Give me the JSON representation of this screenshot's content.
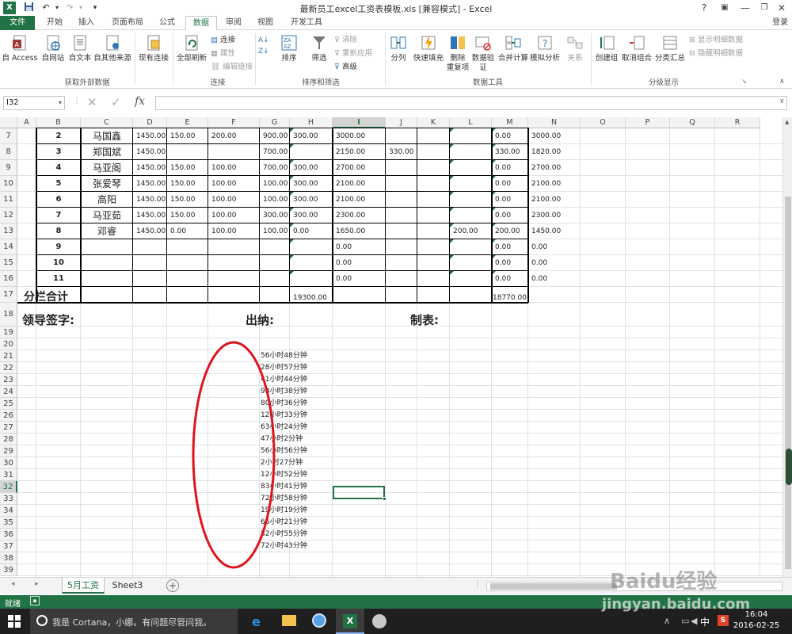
{
  "window": {
    "title": "最新员工excel工资表模板.xls  [兼容模式] - Excel",
    "login": "登录"
  },
  "menu_tabs": [
    "文件",
    "开始",
    "插入",
    "页面布局",
    "公式",
    "数据",
    "审阅",
    "视图",
    "开发工具"
  ],
  "active_tab": "数据",
  "ribbon": {
    "groups": {
      "external": "获取外部数据",
      "connections": "连接",
      "sort_filter": "排序和筛选",
      "data_tools": "数据工具",
      "outline": "分级显示"
    },
    "buttons": {
      "from_access": "自 Access",
      "from_web": "自网站",
      "from_text": "自文本",
      "from_other": "自其他来源",
      "existing": "现有连接",
      "refresh_all": "全部刷新",
      "connections": "连接",
      "properties": "属性",
      "edit_links": "编辑链接",
      "sort": "排序",
      "filter": "筛选",
      "clear": "清除",
      "reapply": "重新应用",
      "advanced": "高级",
      "text_to_cols": "分列",
      "flash_fill": "快速填充",
      "remove_dup_1": "删除",
      "remove_dup_2": "重复项",
      "validation_1": "数据验",
      "validation_2": "证",
      "consolidate": "合并计算",
      "what_if": "模拟分析",
      "relationships": "关系",
      "group": "创建组",
      "ungroup": "取消组合",
      "subtotal": "分类汇总",
      "show_detail": "显示明细数据",
      "hide_detail": "隐藏明细数据"
    }
  },
  "formula_bar": {
    "name_box": "I32",
    "formula": ""
  },
  "columns": [
    "A",
    "B",
    "C",
    "D",
    "E",
    "F",
    "G",
    "H",
    "I",
    "J",
    "K",
    "L",
    "M",
    "N",
    "O",
    "P",
    "Q",
    "R"
  ],
  "rows": [
    "7",
    "8",
    "9",
    "10",
    "11",
    "12",
    "13",
    "14",
    "15",
    "16",
    "17",
    "18",
    "19",
    "20",
    "21",
    "22",
    "23",
    "24",
    "25",
    "26",
    "27",
    "28",
    "29",
    "30",
    "31",
    "32",
    "33",
    "34",
    "35",
    "36",
    "37",
    "38",
    "39"
  ],
  "table_rows": [
    [
      "2",
      "马国鑫",
      "1450.00",
      "150.00",
      "200.00",
      "900.00",
      "300.00",
      "3000.00",
      "",
      "",
      "",
      "0.00",
      "3000.00"
    ],
    [
      "3",
      "郑国斌",
      "1450.00",
      "",
      "",
      "700.00",
      "",
      "2150.00",
      "330.00",
      "",
      "",
      "330.00",
      "1820.00"
    ],
    [
      "4",
      "马亚阁",
      "1450.00",
      "150.00",
      "100.00",
      "700.00",
      "300.00",
      "2700.00",
      "",
      "",
      "",
      "0.00",
      "2700.00"
    ],
    [
      "5",
      "张爱琴",
      "1450.00",
      "150.00",
      "100.00",
      "100.00",
      "300.00",
      "2100.00",
      "",
      "",
      "",
      "0.00",
      "2100.00"
    ],
    [
      "6",
      "高阳",
      "1450.00",
      "150.00",
      "100.00",
      "100.00",
      "300.00",
      "2100.00",
      "",
      "",
      "",
      "0.00",
      "2100.00"
    ],
    [
      "7",
      "马亚茹",
      "1450.00",
      "150.00",
      "100.00",
      "300.00",
      "300.00",
      "2300.00",
      "",
      "",
      "",
      "0.00",
      "2300.00"
    ],
    [
      "8",
      "邓睿",
      "1450.00",
      "0.00",
      "100.00",
      "100.00",
      "0.00",
      "1650.00",
      "",
      "",
      "200.00",
      "200.00",
      "1450.00"
    ],
    [
      "9",
      "",
      "",
      "",
      "",
      "",
      "",
      "0.00",
      "",
      "",
      "",
      "0.00",
      "0.00"
    ],
    [
      "10",
      "",
      "",
      "",
      "",
      "",
      "",
      "0.00",
      "",
      "",
      "",
      "0.00",
      "0.00"
    ],
    [
      "11",
      "",
      "",
      "",
      "",
      "",
      "",
      "0.00",
      "",
      "",
      "",
      "0.00",
      "0.00"
    ]
  ],
  "totals_row": {
    "label": "分栏合计",
    "h": "19300.00",
    "m": "18770.00"
  },
  "signature_row": {
    "leader": "领导签字:",
    "cashier": "出纳:",
    "maker": "制表:"
  },
  "durations": [
    "56小时48分钟",
    "28小时57分钟",
    "41小时44分钟",
    "98小时38分钟",
    "80小时36分钟",
    "12小时33分钟",
    "63小时24分钟",
    "47小时2分钟",
    "56小时56分钟",
    "2小时27分钟",
    "12小时52分钟",
    "83小时41分钟",
    "72小时58分钟",
    "19小时19分钟",
    "66小时21分钟",
    "32小时55分钟",
    "72小时43分钟"
  ],
  "sheet_tabs": [
    "5月工资",
    "Sheet3"
  ],
  "active_sheet": "5月工资",
  "status": {
    "ready": "就绪"
  },
  "taskbar": {
    "cortana": "我是 Cortana，小娜。有问题尽管问我。",
    "ime": "中",
    "time": "16:04",
    "date": "2016-02-25"
  },
  "watermark": {
    "brand": "Baidu经验",
    "url": "jingyan.baidu.com"
  },
  "colors": {
    "excel_green": "#217346",
    "annotation_red": "#e0141e",
    "taskbar": "#1f1f1f"
  }
}
